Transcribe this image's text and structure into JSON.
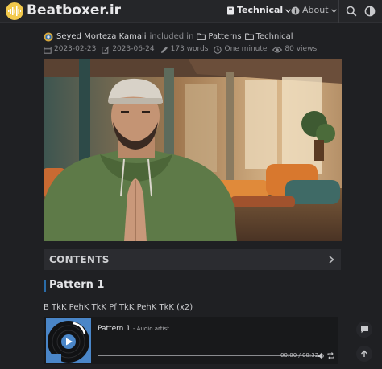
{
  "header": {
    "site_title": "Beatboxer.ir",
    "nav": [
      {
        "label": "Technical",
        "icon": "book-icon"
      },
      {
        "label": "About",
        "icon": "info-icon"
      }
    ],
    "actions": [
      "search-icon",
      "theme-toggle-icon"
    ]
  },
  "post_meta": {
    "author": "Seyed Morteza Kamali",
    "included_in": "included in",
    "categories": [
      "Patterns",
      "Technical"
    ],
    "published": "2023-02-23",
    "updated": "2023-06-24",
    "words": "173 words",
    "reading_time": "One minute",
    "views": "80 views"
  },
  "contents": {
    "label": "CONTENTS"
  },
  "section": {
    "heading": "Pattern 1",
    "pattern": "B TkK PehK TkK Pf TkK PehK TkK (x2)"
  },
  "audio": {
    "title": "Pattern 1",
    "artist": "- Audio artist",
    "time": "00:00 / 00:32"
  },
  "colors": {
    "background": "#1f2023",
    "header": "#252629",
    "accent": "#2a6ca8",
    "logo": "#f2c94c"
  },
  "floating_actions": [
    "comment-icon",
    "back-to-top-icon"
  ]
}
